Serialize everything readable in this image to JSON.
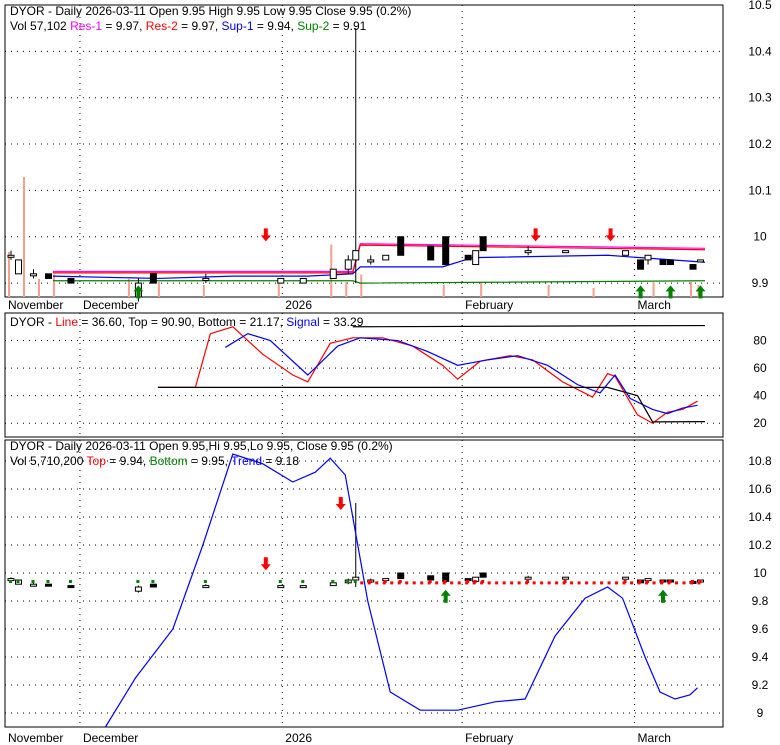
{
  "chart_data": [
    {
      "type": "candlestick",
      "panel": "price",
      "title": "DYOR - Daily 2026-03-11 Open 9.95  High 9.95  Low 9.95  Close 9.95 (0.2%)",
      "legend": [
        {
          "text": "Vol 57,102 ",
          "color": "#000000"
        },
        {
          "text": "Res-1",
          "color": "#ff00ff"
        },
        {
          "text": " = 9.97, ",
          "color": "#000000"
        },
        {
          "text": "Res-2",
          "color": "#ff0000"
        },
        {
          "text": " = 9.97, ",
          "color": "#000000"
        },
        {
          "text": "Sup-1",
          "color": "#0000ff"
        },
        {
          "text": " = 9.94, ",
          "color": "#000000"
        },
        {
          "text": "Sup-2",
          "color": "#008000"
        },
        {
          "text": " = 9.91",
          "color": "#000000"
        }
      ],
      "ylim": [
        9.87,
        10.5
      ],
      "yticks": [
        10.5,
        10.4,
        10.3,
        10.2,
        10.1,
        10.0,
        9.9
      ],
      "xlabels": [
        {
          "label": "November",
          "i": 0
        },
        {
          "label": "December",
          "i": 10
        },
        {
          "label": "2026",
          "i": 37
        },
        {
          "label": "February",
          "i": 61
        },
        {
          "label": "March",
          "i": 84
        }
      ],
      "xmax": 93,
      "candles": [
        [
          0,
          9.96,
          9.97,
          9.95,
          9.96
        ],
        [
          1,
          9.92,
          9.95,
          9.92,
          9.95
        ],
        [
          3,
          9.92,
          9.93,
          9.91,
          9.92
        ],
        [
          5,
          9.92,
          9.92,
          9.91,
          9.91
        ],
        [
          8,
          9.91,
          9.91,
          9.9,
          9.9
        ],
        [
          17,
          9.87,
          9.91,
          9.86,
          9.9
        ],
        [
          19,
          9.92,
          9.92,
          9.9,
          9.9
        ],
        [
          26,
          9.91,
          9.92,
          9.9,
          9.91
        ],
        [
          36,
          9.9,
          9.91,
          9.9,
          9.91
        ],
        [
          39,
          9.9,
          9.91,
          9.9,
          9.91
        ],
        [
          43,
          9.91,
          9.93,
          9.91,
          9.93
        ],
        [
          45,
          9.93,
          9.96,
          9.92,
          9.95
        ],
        [
          46,
          9.95,
          10.45,
          9.9,
          9.97
        ],
        [
          48,
          9.95,
          9.96,
          9.94,
          9.95
        ],
        [
          50,
          9.95,
          9.96,
          9.95,
          9.96
        ],
        [
          52,
          10.0,
          10.0,
          9.96,
          9.96
        ],
        [
          56,
          9.98,
          9.98,
          9.95,
          9.95
        ],
        [
          58,
          10.0,
          10.0,
          9.94,
          9.94
        ],
        [
          61,
          9.96,
          9.96,
          9.95,
          9.95
        ],
        [
          62,
          9.94,
          9.97,
          9.94,
          9.97
        ],
        [
          63,
          10.0,
          10.0,
          9.97,
          9.97
        ],
        [
          69,
          9.97,
          9.98,
          9.96,
          9.97
        ],
        [
          74,
          9.97,
          9.97,
          9.97,
          9.97
        ],
        [
          82,
          9.96,
          9.97,
          9.96,
          9.97
        ],
        [
          84,
          9.95,
          9.95,
          9.93,
          9.93
        ],
        [
          85,
          9.95,
          9.96,
          9.94,
          9.96
        ],
        [
          87,
          9.95,
          9.95,
          9.94,
          9.94
        ],
        [
          88,
          9.95,
          9.95,
          9.94,
          9.94
        ],
        [
          91,
          9.94,
          9.94,
          9.93,
          9.93
        ],
        [
          92,
          9.95,
          9.95,
          9.95,
          9.95
        ]
      ],
      "res1": [
        [
          6,
          9.925
        ],
        [
          34,
          9.925
        ],
        [
          46,
          9.925
        ],
        [
          47,
          9.985
        ],
        [
          93,
          9.975
        ]
      ],
      "sup1": [
        [
          6,
          9.915
        ],
        [
          20,
          9.91
        ],
        [
          30,
          9.915
        ],
        [
          40,
          9.915
        ],
        [
          46,
          9.92
        ],
        [
          47,
          9.935
        ],
        [
          58,
          9.935
        ],
        [
          62,
          9.955
        ],
        [
          80,
          9.96
        ],
        [
          93,
          9.945
        ]
      ],
      "sup2": [
        [
          6,
          9.905
        ],
        [
          46,
          9.905
        ],
        [
          47,
          9.9
        ],
        [
          93,
          9.905
        ]
      ],
      "up_arrows": [
        17,
        84,
        88,
        92
      ],
      "down_arrows": [
        34,
        70,
        80
      ],
      "volume": [
        [
          0,
          0.3
        ],
        [
          2,
          0.8
        ],
        [
          4,
          0.12
        ],
        [
          6,
          0.15
        ],
        [
          16,
          0.12
        ],
        [
          20,
          0.1
        ],
        [
          26,
          0.08
        ],
        [
          36,
          0.1
        ],
        [
          43,
          0.35
        ],
        [
          45,
          0.1
        ],
        [
          47,
          0.15
        ],
        [
          58,
          0.08
        ],
        [
          63,
          0.1
        ],
        [
          72,
          0.08
        ],
        [
          78,
          0.06
        ],
        [
          86,
          0.1
        ],
        [
          91,
          0.1
        ],
        [
          92,
          0.08
        ]
      ]
    },
    {
      "type": "line",
      "panel": "stochastic",
      "legend": [
        {
          "text": "DYOR - ",
          "color": "#000000"
        },
        {
          "text": "Line",
          "color": "#ff0000"
        },
        {
          "text": " = 36.60, Top = 90.90, Bottom = 21.17, ",
          "color": "#000000"
        },
        {
          "text": "Signal",
          "color": "#0000ff"
        },
        {
          "text": " = 33.29",
          "color": "#000000"
        }
      ],
      "ylim": [
        10,
        100
      ],
      "yticks": [
        80,
        60,
        40,
        20
      ],
      "series": [
        {
          "name": "Line",
          "color": "#ff0000",
          "points": [
            [
              20,
              46
            ],
            [
              25,
              46
            ],
            [
              27,
              85
            ],
            [
              30,
              90
            ],
            [
              34,
              70
            ],
            [
              38,
              55
            ],
            [
              40,
              50
            ],
            [
              43,
              78
            ],
            [
              46,
              82
            ],
            [
              50,
              82
            ],
            [
              54,
              76
            ],
            [
              58,
              62
            ],
            [
              60,
              52
            ],
            [
              63,
              65
            ],
            [
              67,
              69
            ],
            [
              70,
              66
            ],
            [
              74,
              50
            ],
            [
              78,
              39
            ],
            [
              80,
              56
            ],
            [
              81,
              54
            ],
            [
              84,
              26
            ],
            [
              86,
              20
            ],
            [
              88,
              28
            ],
            [
              90,
              30
            ],
            [
              92,
              36
            ]
          ]
        },
        {
          "name": "Signal",
          "color": "#0000ff",
          "points": [
            [
              29,
              75
            ],
            [
              32,
              85
            ],
            [
              35,
              80
            ],
            [
              40,
              55
            ],
            [
              44,
              76
            ],
            [
              47,
              82
            ],
            [
              52,
              80
            ],
            [
              56,
              72
            ],
            [
              60,
              62
            ],
            [
              64,
              66
            ],
            [
              68,
              69
            ],
            [
              72,
              62
            ],
            [
              76,
              48
            ],
            [
              79,
              42
            ],
            [
              81,
              55
            ],
            [
              83,
              38
            ],
            [
              86,
              30
            ],
            [
              88,
              27
            ],
            [
              90,
              31
            ],
            [
              92,
              33
            ]
          ]
        },
        {
          "name": "Top",
          "color": "#000000",
          "points": [
            [
              46,
              90
            ],
            [
              93,
              90.9
            ]
          ]
        },
        {
          "name": "Bottom",
          "color": "#000000",
          "points": [
            [
              20,
              46
            ],
            [
              80,
              46
            ],
            [
              84,
              40
            ],
            [
              86,
              21
            ],
            [
              93,
              21.17
            ]
          ]
        }
      ]
    },
    {
      "type": "candlestick",
      "panel": "trend",
      "title": "DYOR - Daily 2026-03-11 Open 9.95,Hi 9.95,Lo 9.95, Close 9.95 (0.2%)",
      "legend": [
        {
          "text": "Vol 5,710,200 ",
          "color": "#000000"
        },
        {
          "text": "Top",
          "color": "#ff0000"
        },
        {
          "text": " = 9.94, ",
          "color": "#000000"
        },
        {
          "text": "Bottom",
          "color": "#008000"
        },
        {
          "text": " = 9.95, ",
          "color": "#000000"
        },
        {
          "text": "Trend",
          "color": "#0000ff"
        },
        {
          "text": " = 9.18",
          "color": "#000000"
        }
      ],
      "ylim": [
        8.9,
        10.95
      ],
      "yticks": [
        10.8,
        10.6,
        10.4,
        10.2,
        10.0,
        9.8,
        9.6,
        9.4,
        9.2,
        9.0
      ],
      "trend": [
        [
          13,
          8.9
        ],
        [
          17,
          9.25
        ],
        [
          22,
          9.6
        ],
        [
          26,
          10.2
        ],
        [
          30,
          10.85
        ],
        [
          34,
          10.78
        ],
        [
          38,
          10.65
        ],
        [
          41,
          10.72
        ],
        [
          43,
          10.82
        ],
        [
          45,
          10.7
        ],
        [
          48,
          9.8
        ],
        [
          51,
          9.15
        ],
        [
          55,
          9.02
        ],
        [
          60,
          9.02
        ],
        [
          65,
          9.08
        ],
        [
          69,
          9.1
        ],
        [
          73,
          9.55
        ],
        [
          77,
          9.82
        ],
        [
          80,
          9.9
        ],
        [
          82,
          9.82
        ],
        [
          85,
          9.4
        ],
        [
          87,
          9.15
        ],
        [
          89,
          9.1
        ],
        [
          91,
          9.13
        ],
        [
          92,
          9.18
        ]
      ],
      "up_arrows": [
        58,
        87
      ],
      "down_arrows": [
        34,
        44
      ]
    }
  ]
}
